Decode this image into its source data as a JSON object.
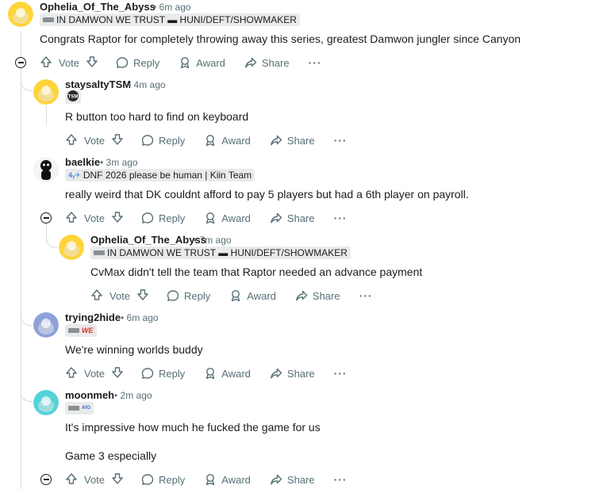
{
  "actions": {
    "vote": "Vote",
    "reply": "Reply",
    "award": "Award",
    "share": "Share",
    "more": "···"
  },
  "comments": [
    {
      "username": "Ophelia_Of_The_Abyss",
      "time": "• 6m ago",
      "flair": "IN DAMWON WE TRUST ▬ HUNI/DEFT/SHOWMAKER",
      "body": [
        "Congrats Raptor for completely throwing away this series, greatest Damwon jungler since Canyon"
      ]
    },
    {
      "username": "staysaltyTSM",
      "time": "• 4m ago",
      "flair": "",
      "body": [
        "R button too hard to find on keyboard"
      ]
    },
    {
      "username": "baelkie",
      "time": "• 3m ago",
      "flair": "DNF 2026 please be human | Kiin Team",
      "body": [
        "really weird that DK couldnt afford to pay 5 players but had a 6th player on payroll."
      ]
    },
    {
      "username": "Ophelia_Of_The_Abyss",
      "time": "• 7m ago",
      "flair": "IN DAMWON WE TRUST ▬ HUNI/DEFT/SHOWMAKER",
      "body": [
        "CvMax didn't tell the team that Raptor needed an advance payment"
      ]
    },
    {
      "username": "trying2hide",
      "time": "• 6m ago",
      "flair": "WE",
      "body": [
        "We're winning worlds buddy"
      ]
    },
    {
      "username": "moonmeh",
      "time": "• 2m ago",
      "flair": "",
      "body": [
        "It's impressive how much he fucked the game for us",
        "Game 3 especially"
      ]
    }
  ],
  "colors": {
    "snoo_yellow": "#ffd43b",
    "snoo_blue": "#8ea2d9",
    "snoo_teal": "#55d3d8",
    "thread_line": "#d7dadc",
    "meta_gray": "#576f76"
  }
}
